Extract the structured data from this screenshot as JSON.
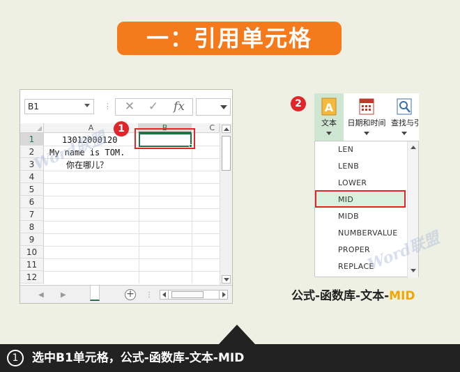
{
  "title": "一：引用单元格",
  "excel": {
    "name_box": "B1",
    "formula_buttons": [
      "✕",
      "✓",
      "fx"
    ],
    "columns": [
      "A",
      "B",
      "C"
    ],
    "rows": [
      "1",
      "2",
      "3",
      "4",
      "5",
      "6",
      "7",
      "8",
      "9",
      "10",
      "11",
      "12"
    ],
    "cells": {
      "A1": "13012000120",
      "A2": "My name is TOM.",
      "A3": "你在哪儿？"
    },
    "add_sheet_label": "+"
  },
  "badges": {
    "one": "1",
    "two": "2"
  },
  "ribbon": {
    "items": [
      {
        "label": "文本",
        "icon": "text-a-icon"
      },
      {
        "label": "日期和时间",
        "icon": "calendar-icon"
      },
      {
        "label": "查找与引",
        "icon": "lookup-magnifier-icon"
      }
    ]
  },
  "function_menu": {
    "items": [
      "LEN",
      "LENB",
      "LOWER",
      "MID",
      "MIDB",
      "NUMBERVALUE",
      "PROPER",
      "REPLACE"
    ],
    "selected": "MID"
  },
  "caption": {
    "prefix": "公式-函数库-文本-",
    "highlight": "MID"
  },
  "watermark": "Word联盟",
  "footer": {
    "step": "1",
    "text": "选中B1单元格，公式-函数库-文本-MID"
  },
  "colors": {
    "accent_orange": "#f47a1c",
    "excel_green": "#217346",
    "highlight_red": "#e0262a",
    "caption_highlight": "#f0a800"
  }
}
